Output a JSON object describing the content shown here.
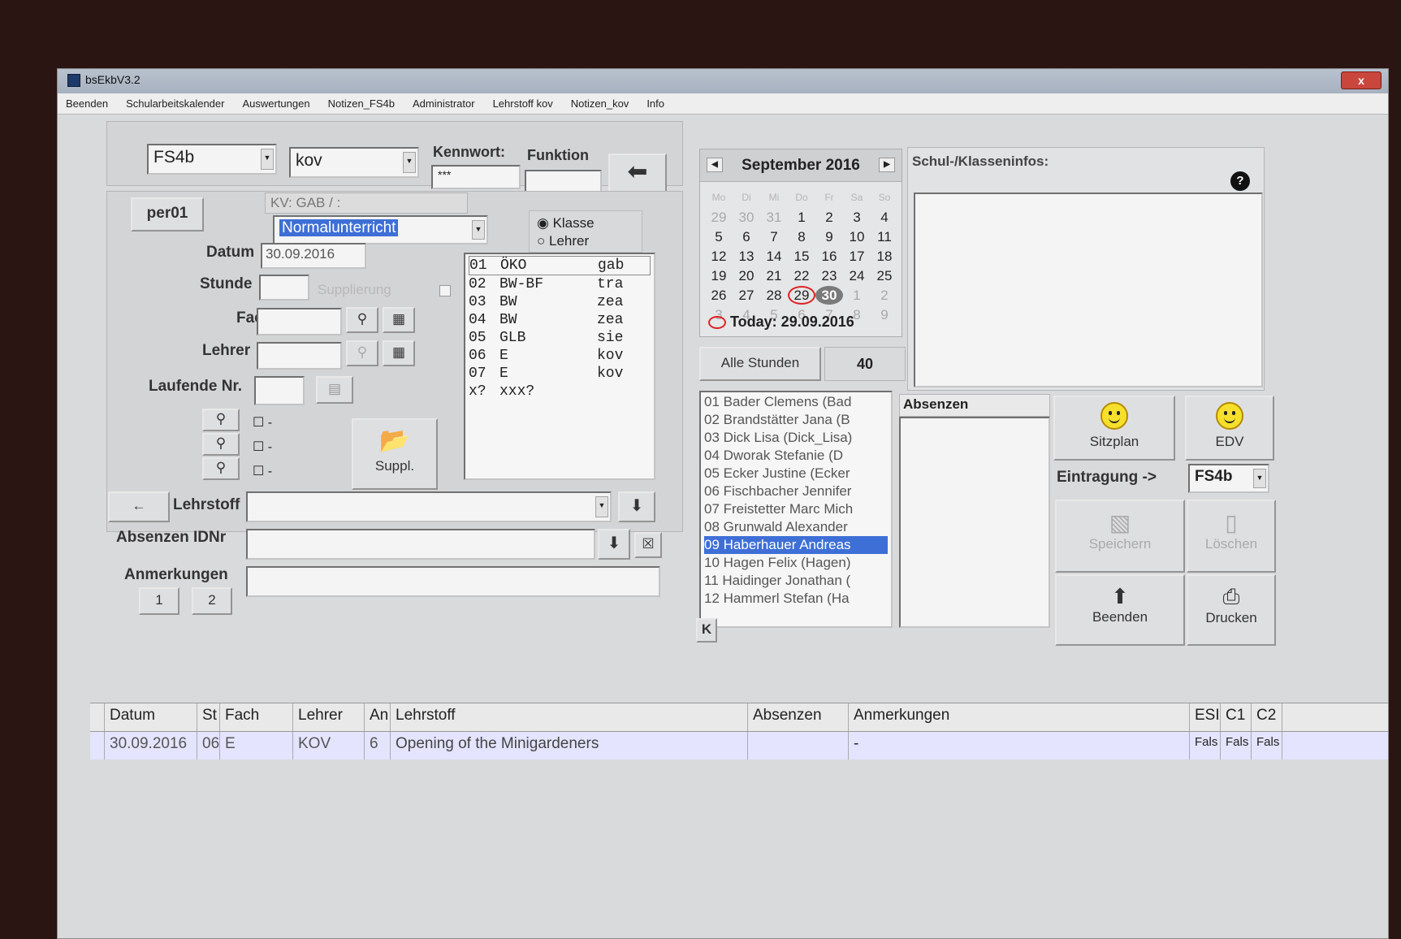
{
  "window": {
    "title": "bsEkbV3.2",
    "close_label": "x"
  },
  "menu": [
    "Beenden",
    "Schularbeitskalender",
    "Auswertungen",
    "Notizen_FS4b",
    "Administrator",
    "Lehrstoff kov",
    "Notizen_kov",
    "Info"
  ],
  "top": {
    "class_select": "FS4b",
    "teacher_select": "kov",
    "kennwort_label": "Kennwort:",
    "kennwort_value": "***",
    "funktion_label": "Funktion",
    "funktion_value": ""
  },
  "entry": {
    "user_badge": "per01",
    "kv_text": "KV: GAB / :",
    "mode_select": "Normalunterricht",
    "radio_klasse": "Klasse",
    "radio_lehrer": "Lehrer",
    "datum_label": "Datum",
    "datum_value": "30.09.2016",
    "stunde_label": "Stunde",
    "supplierung_label": "Supplierung",
    "fach_label": "Fach",
    "lehrer_label": "Lehrer",
    "laufende_label": "Laufende Nr.",
    "suppl_button": "Suppl.",
    "lehrstoff_label": "Lehrstoff",
    "absenzen_label": "Absenzen IDNr",
    "anmerkungen_label": "Anmerkungen",
    "page1": "1",
    "page2": "2",
    "dash": "-"
  },
  "timetable": [
    {
      "no": "01",
      "subject": "ÖKO",
      "teacher": "gab"
    },
    {
      "no": "02",
      "subject": "BW-BF",
      "teacher": "tra"
    },
    {
      "no": "03",
      "subject": "BW",
      "teacher": "zea"
    },
    {
      "no": "04",
      "subject": "BW",
      "teacher": "zea"
    },
    {
      "no": "05",
      "subject": "GLB",
      "teacher": "sie"
    },
    {
      "no": "06",
      "subject": "E",
      "teacher": "kov"
    },
    {
      "no": "07",
      "subject": "E",
      "teacher": "kov"
    },
    {
      "no": "x?",
      "subject": "xxx?",
      "teacher": ""
    }
  ],
  "calendar": {
    "month": "September 2016",
    "weekdays": [
      "Mo",
      "Di",
      "Mi",
      "Do",
      "Fr",
      "Sa",
      "So"
    ],
    "weeks": [
      [
        "29",
        "30",
        "31",
        "1",
        "2",
        "3",
        "4"
      ],
      [
        "5",
        "6",
        "7",
        "8",
        "9",
        "10",
        "11"
      ],
      [
        "12",
        "13",
        "14",
        "15",
        "16",
        "17",
        "18"
      ],
      [
        "19",
        "20",
        "21",
        "22",
        "23",
        "24",
        "25"
      ],
      [
        "26",
        "27",
        "28",
        "29",
        "30",
        "1",
        "2"
      ],
      [
        "3",
        "4",
        "5",
        "6",
        "7",
        "8",
        "9"
      ]
    ],
    "today_label": "Today: 29.09.2016",
    "alle_stunden": "Alle Stunden",
    "count": "40"
  },
  "info": {
    "title": "Schul-/Klasseninfos:",
    "help": "?"
  },
  "students": [
    "01 Bader Clemens (Bad",
    "02 Brandstätter Jana (B",
    "03 Dick Lisa (Dick_Lisa)",
    "04 Dworak Stefanie  (D",
    "05 Ecker Justine (Ecker",
    "06 Fischbacher Jennifer",
    "07 Freistetter Marc Mich",
    "08 Grunwald Alexander",
    "09 Haberhauer Andreas",
    "10 Hagen Felix (Hagen)",
    "11 Haidinger Jonathan (",
    "12 Hammerl Stefan (Ha"
  ],
  "selected_student": 8,
  "k_button": "K",
  "absenzen_header": "Absenzen",
  "actions": {
    "sitzplan": "Sitzplan",
    "edv": "EDV",
    "eintragung": "Eintragung ->",
    "eintragung_select": "FS4b",
    "speichern": "Speichern",
    "loeschen": "Löschen",
    "beenden": "Beenden",
    "drucken": "Drucken"
  },
  "grid": {
    "columns": [
      "Datum",
      "St",
      "Fach",
      "Lehrer",
      "An",
      "Lehrstoff",
      "Absenzen",
      "Anmerkungen",
      "ESI",
      "C1",
      "C2"
    ],
    "rows": [
      [
        "30.09.2016",
        "06",
        "E",
        "KOV",
        "6",
        "Opening of the Minigardeners",
        "",
        "-",
        "Fals",
        "Fals",
        "Fals"
      ]
    ]
  }
}
